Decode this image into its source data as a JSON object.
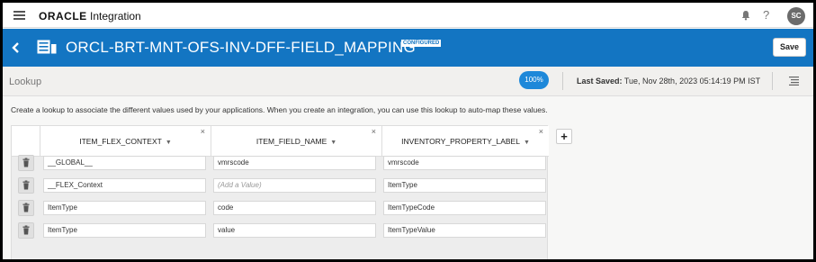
{
  "topbar": {
    "brand_oracle": "ORACLE",
    "brand_product": "Integration",
    "help": "?",
    "avatar_initials": "SC"
  },
  "header": {
    "title": "ORCL-BRT-MNT-OFS-INV-DFF-FIELD_MAPPING",
    "badge": "CONFIGURED",
    "save_label": "Save"
  },
  "subbar": {
    "title": "Lookup",
    "zoom": "100%",
    "last_saved_label": "Last Saved:",
    "last_saved_value": " Tue, Nov 28th, 2023 05:14:19 PM IST"
  },
  "description": "Create a lookup to associate the different values used by your applications. When you create an integration, you can use this lookup to auto-map these values.",
  "table": {
    "columns": [
      "ITEM_FLEX_CONTEXT",
      "ITEM_FIELD_NAME",
      "INVENTORY_PROPERTY_LABEL"
    ],
    "rows": [
      [
        "__GLOBAL__",
        "vmrscode",
        "vmrscode"
      ],
      [
        "__FLEX_Context",
        "",
        "ItemType"
      ],
      [
        "ItemType",
        "code",
        "ItemTypeCode"
      ],
      [
        "ItemType",
        "value",
        "ItemTypeValue"
      ]
    ],
    "placeholder": "(Add a Value)"
  },
  "add_column_label": "+"
}
